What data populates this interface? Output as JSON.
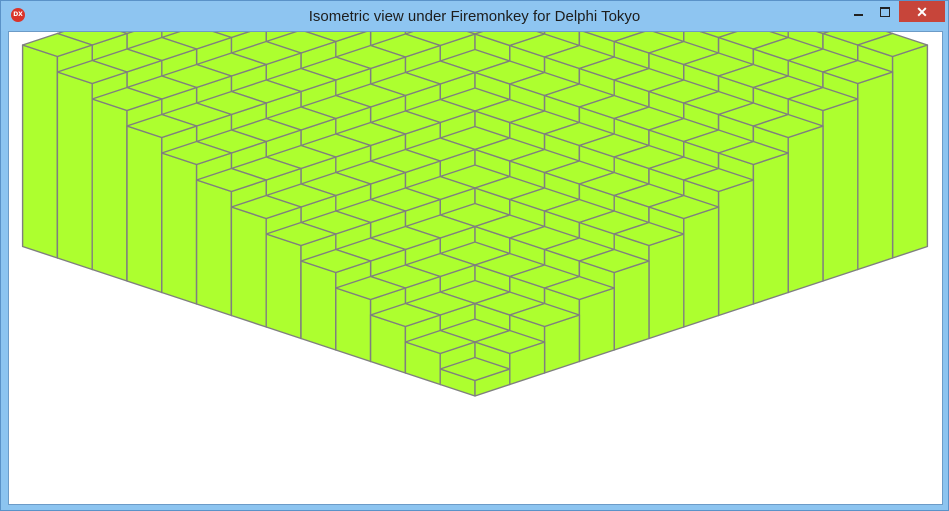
{
  "window": {
    "title": "Isometric view under Firemonkey for Delphi Tokyo",
    "app_icon_text": "DX"
  },
  "controls": {
    "minimize": "minimize-icon",
    "maximize": "maximize-icon",
    "close": "close-icon",
    "close_glyph": "✕"
  },
  "scene": {
    "grid_size": 13,
    "block_color": "#adff2f",
    "edge_color": "#7f7f7f",
    "base_height": 1,
    "height_rule": "max(i,j)",
    "height_step_units": 1
  }
}
